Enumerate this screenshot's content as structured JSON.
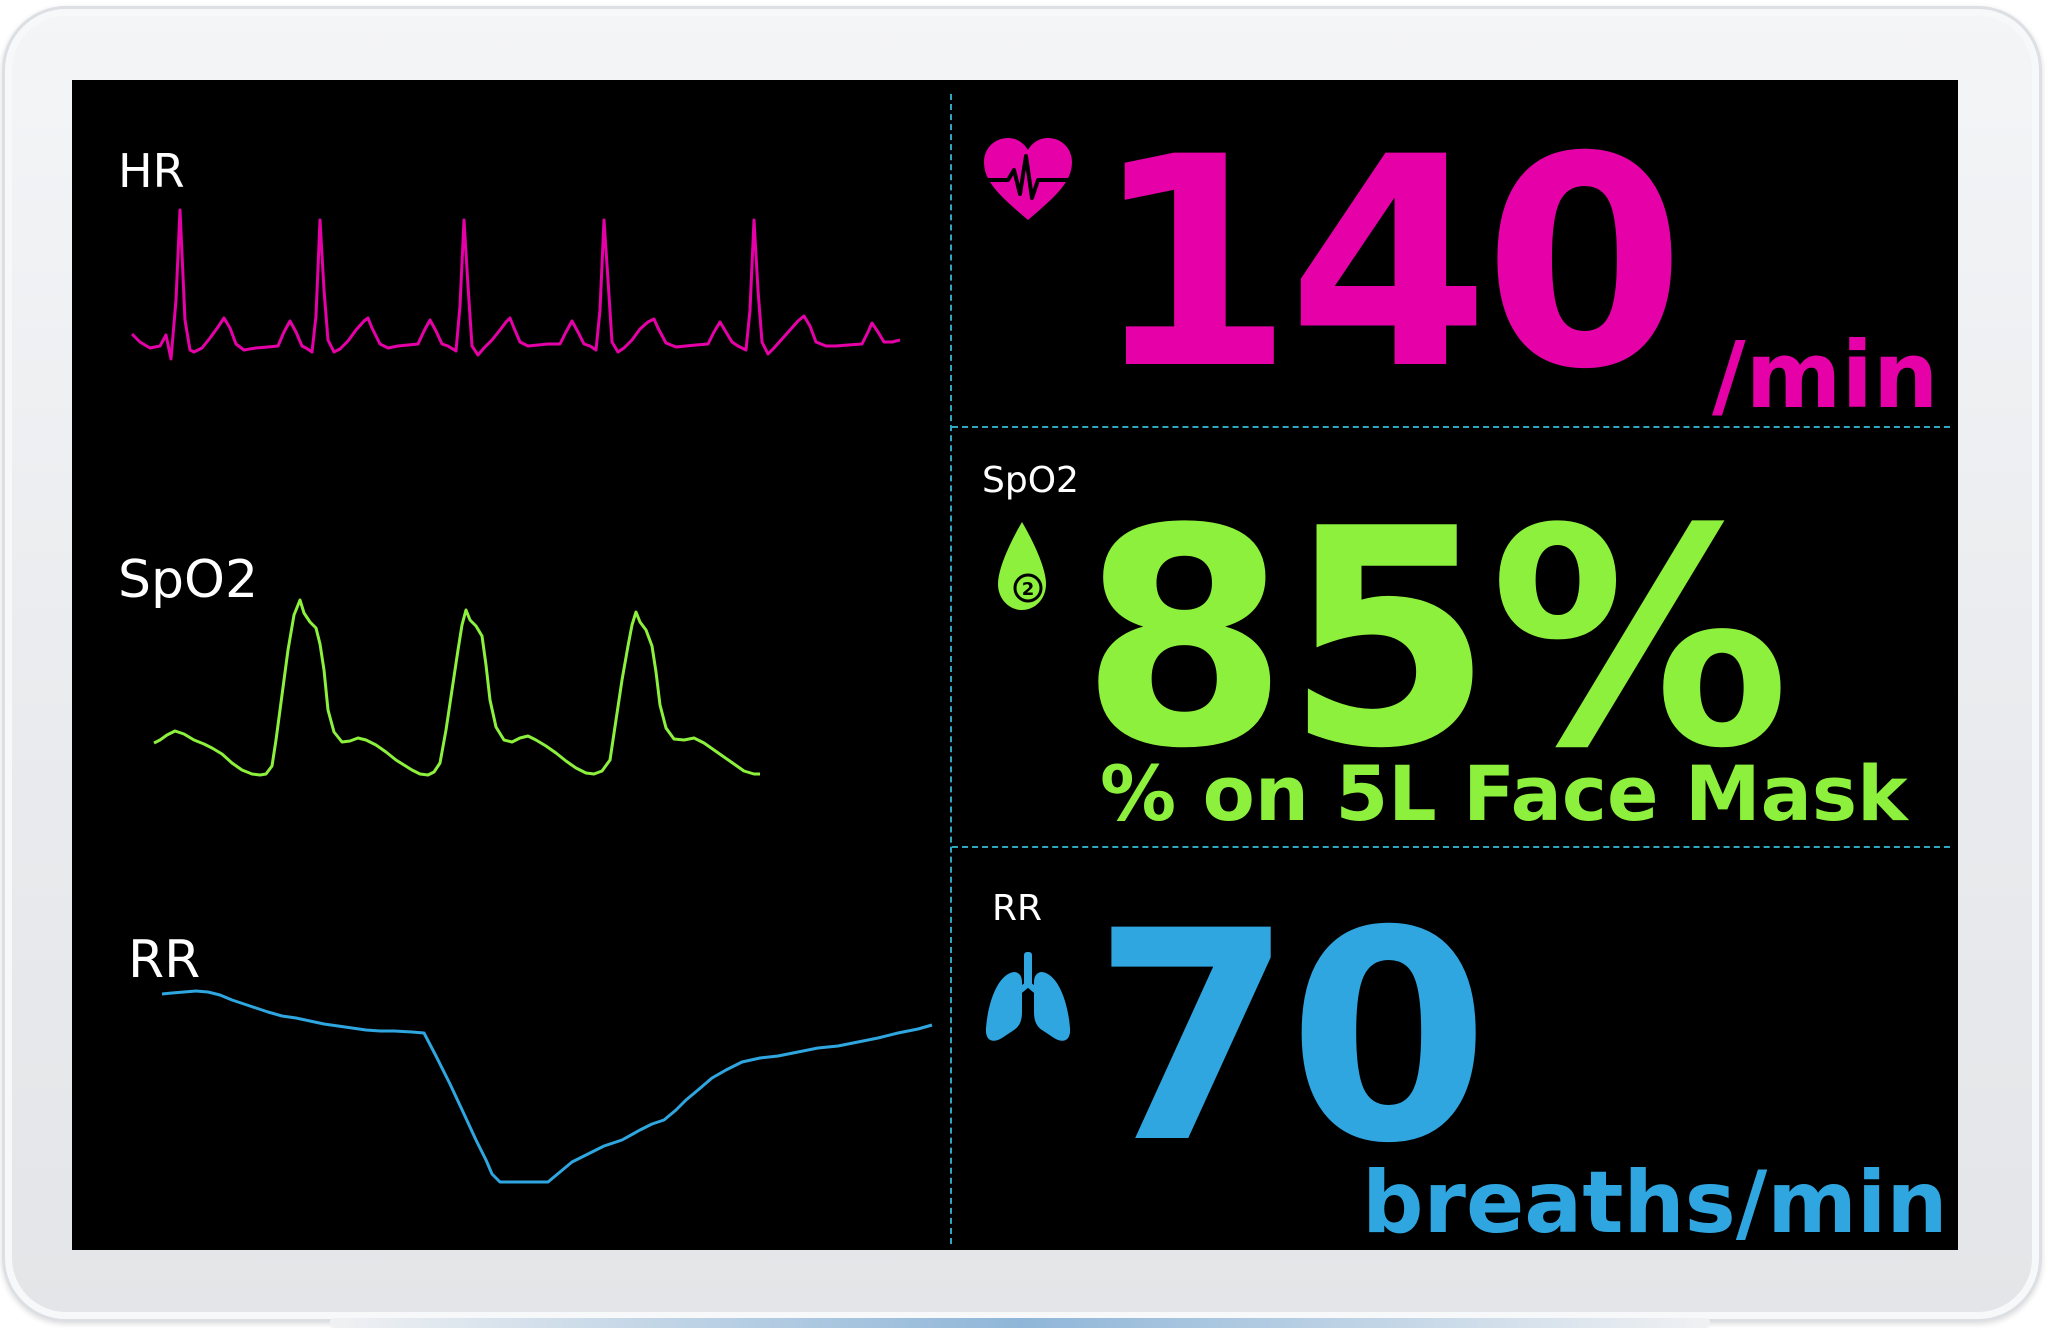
{
  "colors": {
    "hr": "#e600a8",
    "spo2": "#8cf03c",
    "rr": "#2fa6e0",
    "divider": "#2fa8bf",
    "screen": "#000000",
    "label": "#ffffff"
  },
  "waveforms": {
    "hr_label": "HR",
    "spo2_label": "SpO2",
    "rr_label": "RR"
  },
  "readings": {
    "hr": {
      "icon": "heart-ecg-icon",
      "value": "140",
      "unit": "/min"
    },
    "spo2": {
      "label": "SpO2",
      "icon": "oxygen-drop-icon",
      "value": "85%",
      "note": "% on 5L Face Mask"
    },
    "rr": {
      "label": "RR",
      "icon": "lungs-icon",
      "value": "70",
      "unit": "breaths/min"
    }
  }
}
